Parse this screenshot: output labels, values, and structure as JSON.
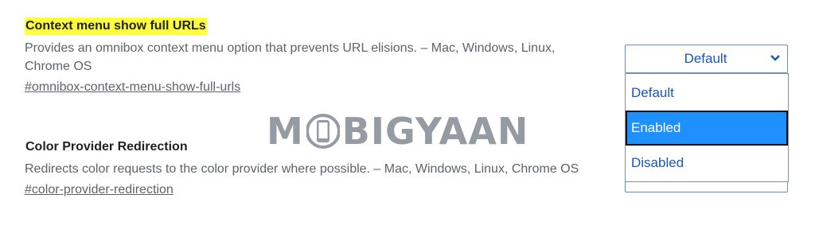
{
  "flags": [
    {
      "title": "Context menu show full URLs",
      "highlighted": true,
      "description": "Provides an omnibox context menu option that prevents URL elisions. – Mac, Windows, Linux, Chrome OS",
      "link": "#omnibox-context-menu-show-full-urls",
      "select": {
        "value": "Default",
        "open": true,
        "options": [
          "Default",
          "Enabled",
          "Disabled"
        ],
        "highlighted_option": "Enabled"
      }
    },
    {
      "title": "Color Provider Redirection",
      "highlighted": false,
      "description": "Redirects color requests to the color provider where possible. – Mac, Windows, Linux, Chrome OS",
      "link": "#color-provider-redirection",
      "select": {
        "value": "Default",
        "open": false
      }
    }
  ],
  "watermark": {
    "text_before": "M",
    "text_after": "BIGYAAN",
    "icon": "phone-icon"
  },
  "colors": {
    "title_highlight": "#ffff3c",
    "select_text": "#1a56b8",
    "selected_option_bg": "#1e90ff",
    "watermark": "#8a9198"
  },
  "icons": {
    "select_chevron": "chevron-down-icon"
  }
}
